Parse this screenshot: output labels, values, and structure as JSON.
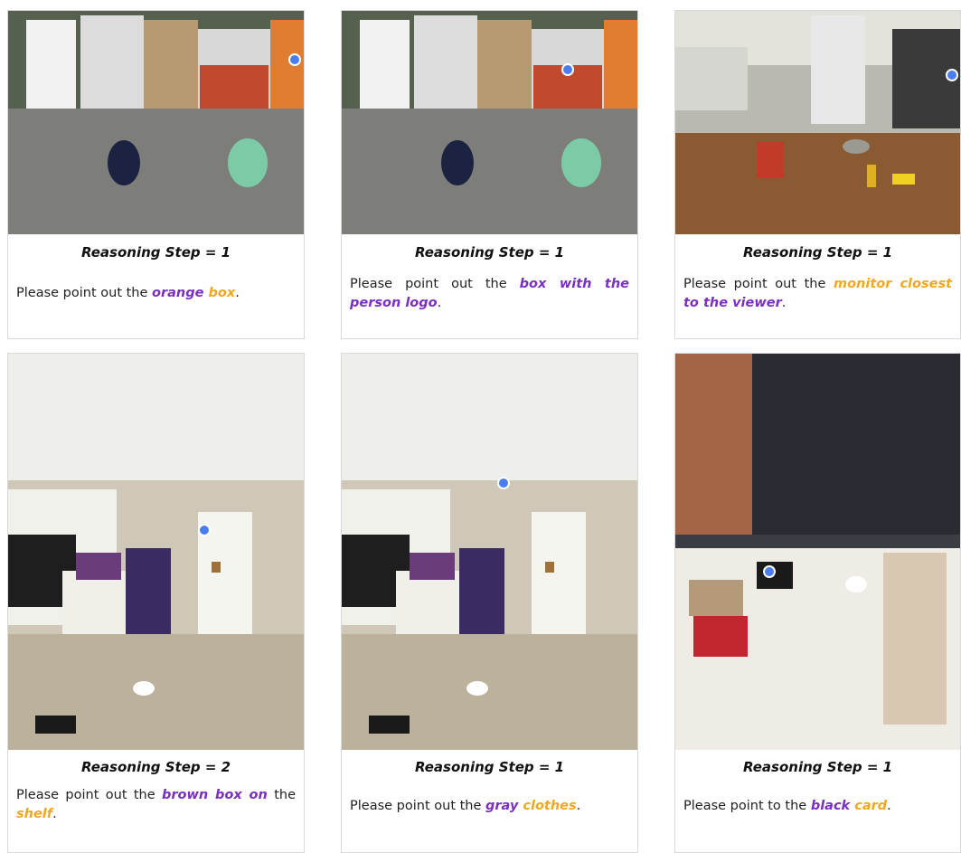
{
  "step_prefix": "Reasoning Step = ",
  "cards": [
    {
      "step": "1",
      "prompt_pre": "Please point out the ",
      "phrase": [
        [
          "orange",
          "purple"
        ],
        [
          " box",
          "orange"
        ]
      ],
      "prompt_post": "."
    },
    {
      "step": "1",
      "prompt_pre": "Please point out the ",
      "phrase": [
        [
          "box with the person logo",
          "purple"
        ]
      ],
      "prompt_post": "."
    },
    {
      "step": "1",
      "prompt_pre": "Please point out the ",
      "phrase": [
        [
          "monitor closest",
          "orange"
        ],
        [
          " to the viewer",
          "purple"
        ]
      ],
      "prompt_post": "."
    },
    {
      "step": "2",
      "prompt_pre": "Please point out the ",
      "phrase": [
        [
          "brown box on",
          "purple"
        ]
      ],
      "prompt_mid": " the ",
      "phrase2": [
        [
          "shelf",
          "orange"
        ]
      ],
      "prompt_post": "."
    },
    {
      "step": "1",
      "prompt_pre": "Please point out the ",
      "phrase": [
        [
          "gray",
          "purple"
        ],
        [
          " clothes",
          "orange"
        ]
      ],
      "prompt_post": "."
    },
    {
      "step": "1",
      "prompt_pre": "Please point to the ",
      "phrase": [
        [
          "black",
          "purple"
        ],
        [
          " card",
          "orange"
        ]
      ],
      "prompt_post": "."
    }
  ],
  "colors": {
    "purple": "#7a2fbf",
    "orange": "#f0a820",
    "marker": "#4a7df2"
  }
}
